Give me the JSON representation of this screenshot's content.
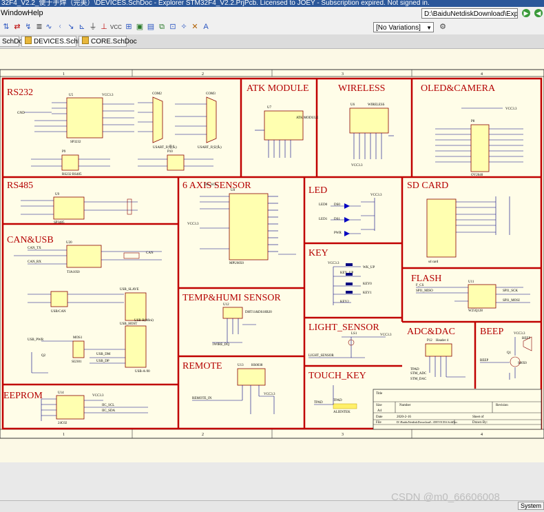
{
  "window": {
    "title": "32F4_V2.2_便于手焊（完美）\\DEVICES.SchDoc - Explorer STM32F4_V2.2.PrjPcb. Licensed to JOEY - Subscription expired. Not signed in."
  },
  "menu": {
    "items": [
      "Window",
      "Help"
    ],
    "path": "D:\\BaiduNetdiskDownload\\Exp"
  },
  "toolbar": {
    "variant": "[No Variations]"
  },
  "tabs": [
    {
      "label": "SchDoc"
    },
    {
      "label": "DEVICES.SchDoc"
    },
    {
      "label": "CORE.SchDoc"
    }
  ],
  "ruler": {
    "top": [
      "1",
      "2",
      "3",
      "4"
    ],
    "bottom": [
      "1",
      "2",
      "3",
      "4"
    ]
  },
  "sections": {
    "rs232": "RS232",
    "atk": "ATK MODULE",
    "wireless": "WIRELESS",
    "oled": "OLED&CAMERA",
    "rs485": "RS485",
    "sixaxis": "6 AXIS SENSOR",
    "led": "LED",
    "sdcard": "SD CARD",
    "canusb": "CAN&USB",
    "key": "KEY",
    "flash": "FLASH",
    "temphumi": "TEMP&HUMI SENSOR",
    "light": "LIGHT_SENSOR",
    "adcdac": "ADC&DAC",
    "beep": "BEEP",
    "remote": "REMOTE",
    "touchkey": "TOUCH_KEY",
    "eeprom": "EEPROM"
  },
  "components": {
    "u5": "U5",
    "sp3232": "SP3232",
    "com2": "COM2",
    "com3": "COM3",
    "usart2": "USART_F(母头)",
    "usart3": "USART_F(公头)",
    "p9": "P9",
    "p10": "P10",
    "rs232_485": "RS232 RS485",
    "u7": "U7",
    "atkmodule": "ATK MODULE",
    "u6": "U6",
    "wirelesschip": "WIRELESS",
    "p8": "P8",
    "ov2640": "OV2640",
    "u9": "U9",
    "sp3485": "SP3485",
    "u8": "U8",
    "mpu6050": "MPU6050",
    "ds0": "DS0",
    "ds1": "DS1",
    "pwr": "PWR",
    "sdcard_label": "sd card",
    "u20": "U20",
    "tja1050": "TJA1050",
    "can": "CAN",
    "usbslave": "USB_SLAVE",
    "usbhost": "USB_HOST",
    "usbb": "USB-B(Mini)",
    "usba": "USB-A-90",
    "usbcan": "USB/CAN",
    "u11": "U11",
    "w25q128": "W25Q128",
    "u12": "U12",
    "dht": "DHT11&DS18B20",
    "ls1": "LS1",
    "p12": "P12",
    "header4": "Header 4",
    "beep_ref": "BEEP",
    "q1": "Q1",
    "s8050": "S8050",
    "u13": "U13",
    "hs0038": "HS0038",
    "u14": "U14",
    "24c02": "24C02",
    "tpad": "TPAD",
    "alientek": "ALIENTEK",
    "q2": "Q2",
    "mos1": "MOS1",
    "si2301": "SI2301"
  },
  "nets": {
    "wkup": "WK_UP",
    "key0": "KEY0",
    "key1": "KEY1",
    "key2": "KEY2",
    "keyup": "KEY_UP",
    "led0": "LED0",
    "led1": "LED1",
    "remote_in": "REMOTE_IN",
    "wire_dq": "1WIRE_DQ",
    "light_sensor": "LIGHT_SENSOR",
    "beep_net": "BEEP",
    "tpad_net": "TPAD",
    "can_tx": "CAN_TX",
    "can_rx": "CAN_RX",
    "usb_pwr": "USB_PWR",
    "usb_dm": "USB_DM",
    "usb_dp": "USB_DP",
    "iic_scl": "IIC_SCL",
    "iic_sda": "IIC_SDA",
    "f_cs": "F_CS",
    "spi_miso": "SPI1_MISO",
    "spi_mosi": "SPI1_MOSI",
    "spi_sck": "SPI1_SCK",
    "stm_adc": "STM_ADC",
    "stm_dac": "STM_DAC",
    "vcc33": "VCC3.3",
    "gnd": "GND"
  },
  "titleblock": {
    "title": "Title",
    "size_label": "Size",
    "size": "A4",
    "number_label": "Number",
    "revision_label": "Revision",
    "date_label": "Date",
    "date": "2020-2-16",
    "sheet_label": "Sheet of",
    "file_label": "File",
    "file": "D:\\BaiduNetdiskDownload\\..\\DEVICES.SchDoc",
    "drawn_label": "Drawn By:"
  },
  "statusbar": {
    "system": "System"
  },
  "watermark": "CSDN @m0_66606008",
  "colors": {
    "section_border": "#c00000",
    "section_text": "#b40000",
    "wire": "#000080",
    "part_fill": "#ffffb0",
    "sheet_bg": "#fffde8",
    "titlebar": "#2b579a"
  }
}
